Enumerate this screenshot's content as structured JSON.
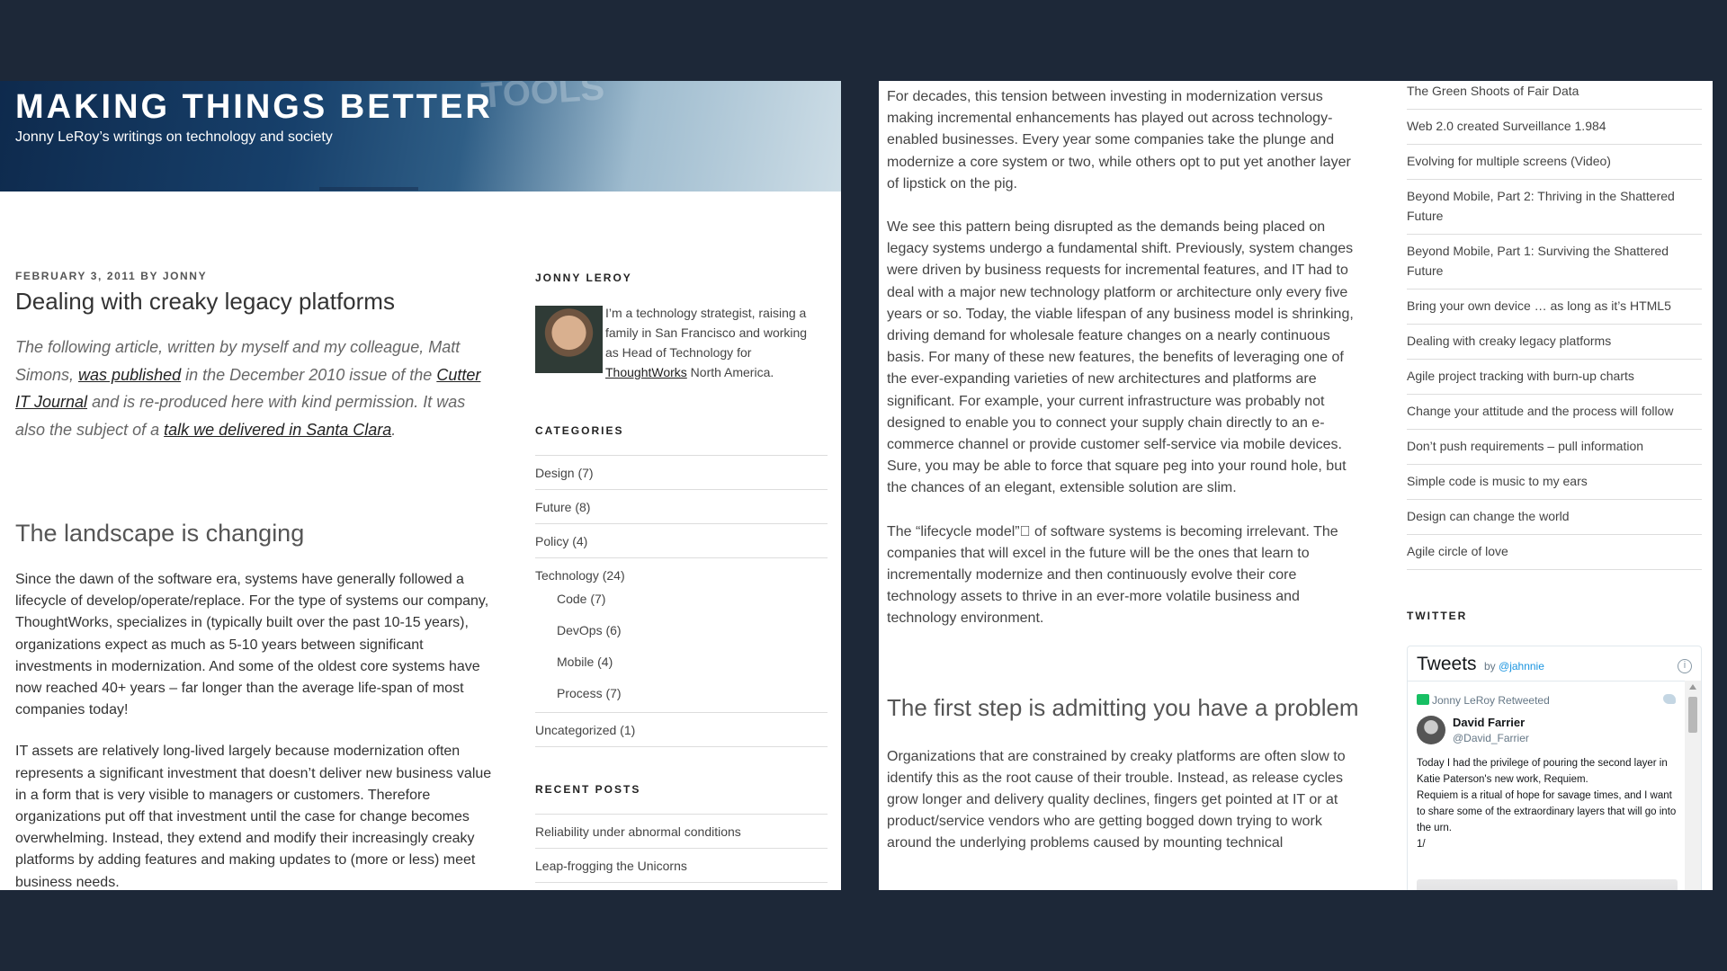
{
  "header": {
    "title": "MAKING THINGS BETTER",
    "tagline": "Jonny LeRoy’s writings on technology and society"
  },
  "post": {
    "meta": "February 3, 2011 by Jonny",
    "title": "Dealing with creaky legacy platforms",
    "intro_1": "The following article, written by myself and my colleague, Matt Simons,",
    "intro_link_1": "was published",
    "intro_2": "in the December 2010 issue of the",
    "intro_link_2": "Cutter IT Journal",
    "intro_3": "and is re-produced here with kind permission. It was also the subject of a",
    "intro_link_3": "talk we delivered in Santa Clara",
    "intro_4": ".",
    "section_1_heading": "The landscape is changing",
    "para_1": "Since the dawn of the software era, systems have generally followed a lifecycle of develop/operate/replace. For the type of systems our company, ThoughtWorks, specializes in (typically built over the past 10-15 years), organizations expect as much as 5-10 years between significant investments in modernization. And some of the oldest core systems have now reached 40+ years – far longer than the average life-span of most companies today!",
    "para_2": "IT assets are relatively long-lived largely because modernization often represents a significant investment that doesn’t deliver new business value in a form that is very visible to managers or customers. Therefore organizations put off that investment until the case for change becomes overwhelming. Instead, they extend and modify their increasingly creaky platforms by adding features and making updates to (more or less) meet business needs.",
    "para_3": "For decades, this tension between investing in modernization versus making incremental enhancements has played out across technology-enabled businesses. Every year some companies take the plunge and modernize a core system or two, while others opt to put yet another layer of lipstick on the pig.",
    "para_4": "We see this pattern being disrupted as the demands being placed on legacy systems undergo a fundamental shift. Previously, system changes were driven by business requests for incremental features, and IT had to deal with a major new technology platform or architecture only every five years or so. Today, the viable lifespan of any business model is shrinking, driving demand for wholesale feature changes on a nearly continuous basis. For many of these new features, the benefits of leveraging one of the ever-expanding varieties of new architectures and platforms are significant. For example, your current infrastructure was probably not designed to enable you to connect your supply chain directly to an e-commerce channel or provide customer self-service via mobile devices. Sure, you may be able to force that square peg into your round hole, but the chances of an elegant, extensible solution are slim.",
    "para_5": "The “lifecycle model”\u0000 of software systems is becoming irrelevant. The companies that will excel in the future will be the ones that learn to incrementally modernize and then continuously evolve their core technology assets to thrive in an ever-more volatile business and technology environment.",
    "section_2_heading": "The first step is admitting you have a problem",
    "para_6": "Organizations that are constrained by creaky platforms are often slow to identify this as the root cause of their trouble. Instead, as release cycles grow longer and delivery quality declines, fingers get pointed at IT or at product/service vendors who are getting bogged down trying to work around the underlying problems caused by mounting technical"
  },
  "sidebar": {
    "about_title": "JONNY LEROY",
    "about_text": "I’m a technology strategist, raising a family in San Francisco and working as Head of Technology for",
    "about_link": "ThoughtWorks",
    "about_tail": " North America.",
    "categories_title": "CATEGORIES",
    "categories": [
      {
        "label": "Design (7)"
      },
      {
        "label": "Future (8)"
      },
      {
        "label": "Policy (4)"
      },
      {
        "label": "Technology (24)"
      },
      {
        "label": "Uncategorized (1)"
      }
    ],
    "subcategories": [
      {
        "label": "Code (7)"
      },
      {
        "label": "DevOps (6)"
      },
      {
        "label": "Mobile (4)"
      },
      {
        "label": "Process (7)"
      }
    ],
    "recent_title": "RECENT POSTS",
    "recent_posts_left": [
      {
        "label": "Reliability under abnormal conditions"
      },
      {
        "label": "Leap-frogging the Unicorns"
      }
    ],
    "recent_posts_right": [
      {
        "label": "The Green Shoots of Fair Data"
      },
      {
        "label": "Web 2.0 created Surveillance 1.984"
      },
      {
        "label": "Evolving for multiple screens (Video)"
      },
      {
        "label": "Beyond Mobile, Part 2: Thriving in the Shattered Future"
      },
      {
        "label": "Beyond Mobile, Part 1: Surviving the Shattered Future"
      },
      {
        "label": "Bring your own device … as long as it’s HTML5"
      },
      {
        "label": "Dealing with creaky legacy platforms"
      },
      {
        "label": "Agile project tracking with burn-up charts"
      },
      {
        "label": "Change your attitude and the process will follow"
      },
      {
        "label": "Don’t push requirements – pull information"
      },
      {
        "label": "Simple code is music to my ears"
      },
      {
        "label": "Design can change the world"
      },
      {
        "label": "Agile circle of love"
      }
    ],
    "twitter_title": "TWITTER"
  },
  "tweets": {
    "title": "Tweets",
    "by": "by",
    "handle": "@jahnnie",
    "info": "i",
    "retweeted": "Jonny LeRoy Retweeted",
    "author": "David Farrier",
    "author_handle": "@David_Farrier",
    "text": "Today I had the privilege of pouring the second layer in Katie Paterson's new work, Requiem.\nRequiem is a ritual of hope for savage times, and I want to share some of the extraordinary layers that will go into the urn.\n1/"
  }
}
